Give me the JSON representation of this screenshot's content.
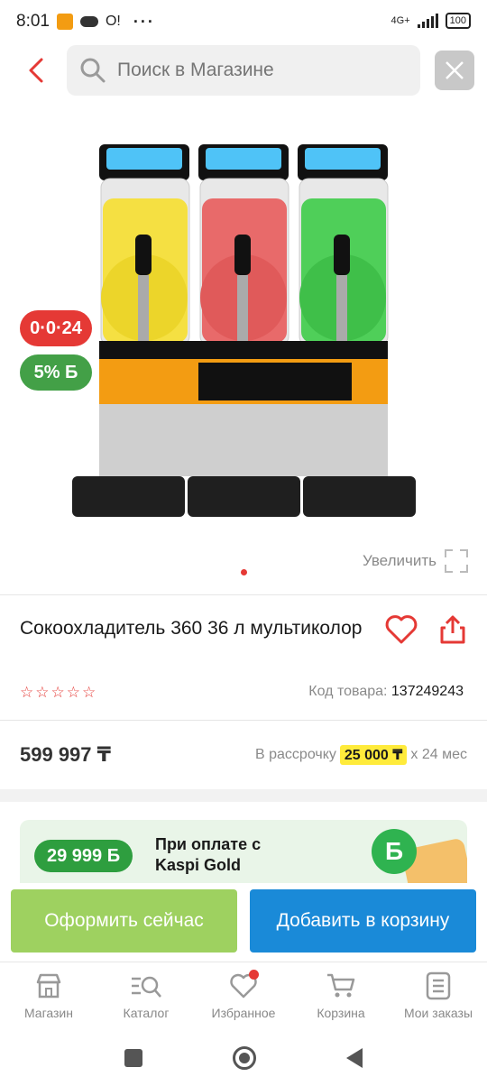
{
  "status_bar": {
    "time": "8:01",
    "app_icon_text": "",
    "extra_text": "O!",
    "dots": "···",
    "network": "4G+",
    "battery": "100"
  },
  "search": {
    "placeholder": "Поиск в Магазине"
  },
  "product": {
    "badge_installment": "0·0·24",
    "badge_bonus": "5% Б",
    "zoom_label": "Увеличить",
    "title": "Сокоохладитель 360 36 л мультиколор",
    "rating_stars": 0,
    "rating_max": 5,
    "sku_label": "Код товара:",
    "sku_value": "137249243",
    "price": "599 997 ₸",
    "installment_label": "В рассрочку",
    "installment_amount": "25 000 ₸",
    "installment_term": "х 24 мес"
  },
  "kaspi_gold": {
    "amount": "29 999 Б",
    "line1": "При оплате с",
    "line2": "Kaspi Gold",
    "logo_letter": "Б"
  },
  "actions": {
    "checkout": "Оформить сейчас",
    "add_to_cart": "Добавить в корзину"
  },
  "tabs": [
    {
      "label": "Магазин",
      "icon": "shop-icon"
    },
    {
      "label": "Каталог",
      "icon": "catalog-icon"
    },
    {
      "label": "Избранное",
      "icon": "heart-icon"
    },
    {
      "label": "Корзина",
      "icon": "cart-icon"
    },
    {
      "label": "Мои заказы",
      "icon": "orders-icon"
    }
  ],
  "colors": {
    "accent_red": "#e53935",
    "accent_green": "#43a047",
    "checkout_green": "#9ed160",
    "cart_blue": "#1a8ad8",
    "highlight_yellow": "#ffeb3b"
  }
}
